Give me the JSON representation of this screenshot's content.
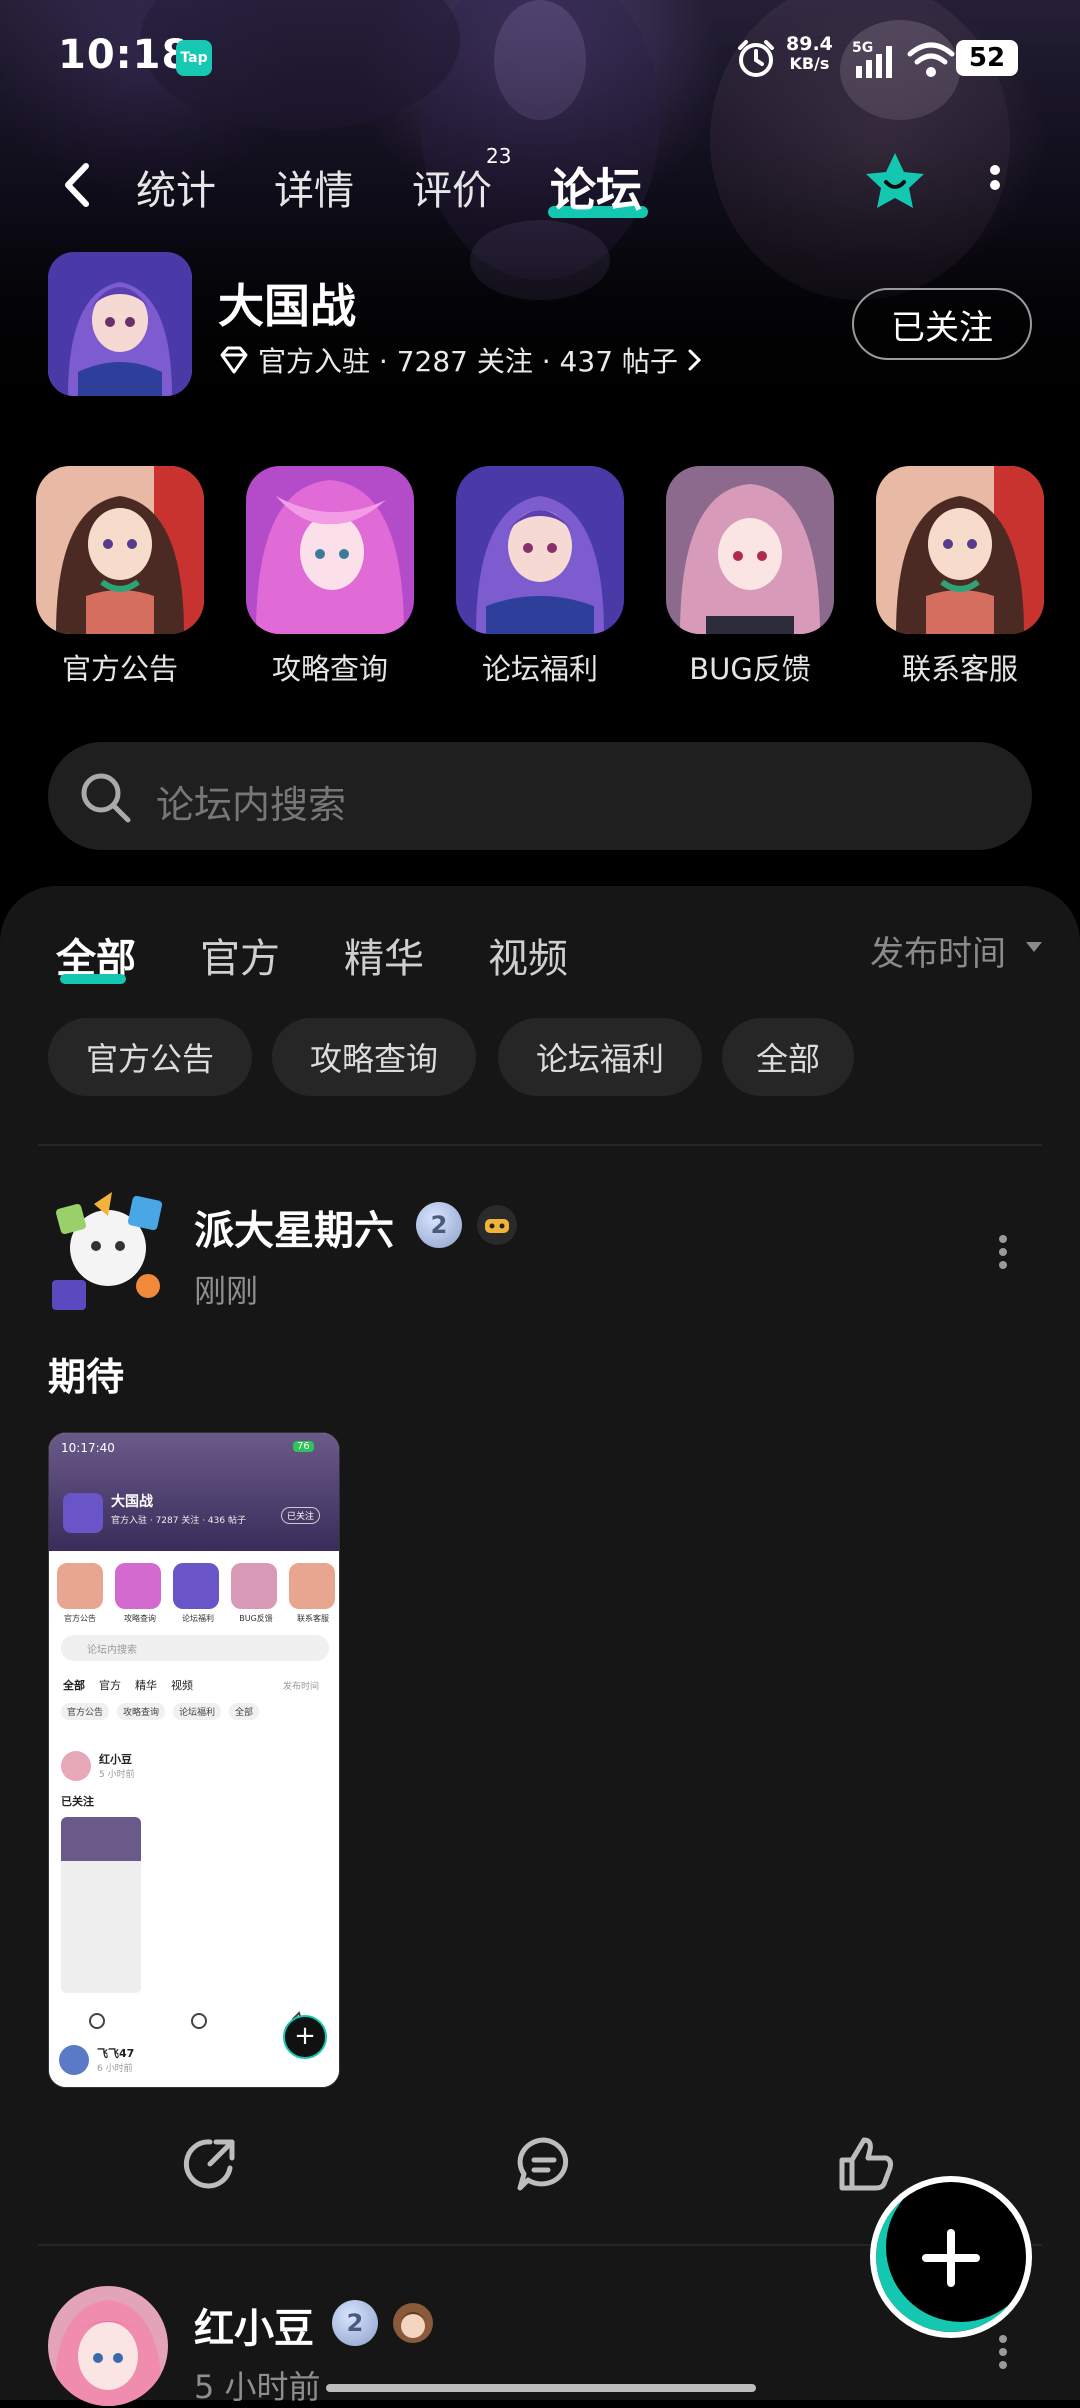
{
  "status_bar": {
    "time": "10:18",
    "tap_badge": "Tap",
    "net_speed": "89.4",
    "net_unit": "KB/s",
    "network_type": "5G",
    "battery": "52"
  },
  "nav": {
    "tabs": [
      "统计",
      "详情",
      "评价",
      "论坛"
    ],
    "active_tab": "论坛",
    "review_count": "23",
    "accent": "#13c7b0"
  },
  "game": {
    "title": "大国战",
    "meta": "官方入驻 · 7287 关注 · 437 帖子",
    "follow_label": "已关注"
  },
  "categories": [
    {
      "label": "官方公告"
    },
    {
      "label": "攻略查询"
    },
    {
      "label": "论坛福利"
    },
    {
      "label": "BUG反馈"
    },
    {
      "label": "联系客服"
    }
  ],
  "search": {
    "placeholder": "论坛内搜索"
  },
  "feed": {
    "tabs": [
      "全部",
      "官方",
      "精华",
      "视频"
    ],
    "sort_label": "发布时间",
    "chips": [
      "官方公告",
      "攻略查询",
      "论坛福利",
      "全部"
    ]
  },
  "posts": [
    {
      "user": "派大星期六",
      "level": "2",
      "time": "刚刚",
      "text": "期待"
    },
    {
      "user": "红小豆",
      "level": "2",
      "time": "5 小时前"
    }
  ],
  "thumbnail": {
    "time": "10:17:40",
    "battery": "76",
    "title": "大国战",
    "meta": "官方入驻 · 7287 关注 · 436 帖子",
    "follow": "已关注",
    "cats": [
      "官方公告",
      "攻略查询",
      "论坛福利",
      "BUG反馈",
      "联系客服"
    ],
    "search": "论坛内搜索",
    "tabs": [
      "全部",
      "官方",
      "精华",
      "视频"
    ],
    "sort": "发布时间",
    "chips": [
      "官方公告",
      "攻略查询",
      "论坛福利",
      "全部"
    ],
    "post_user": "红小豆",
    "post_time": "5 小时前",
    "post_text": "已关注",
    "next_user": "飞飞47",
    "next_time": "6 小时前"
  }
}
